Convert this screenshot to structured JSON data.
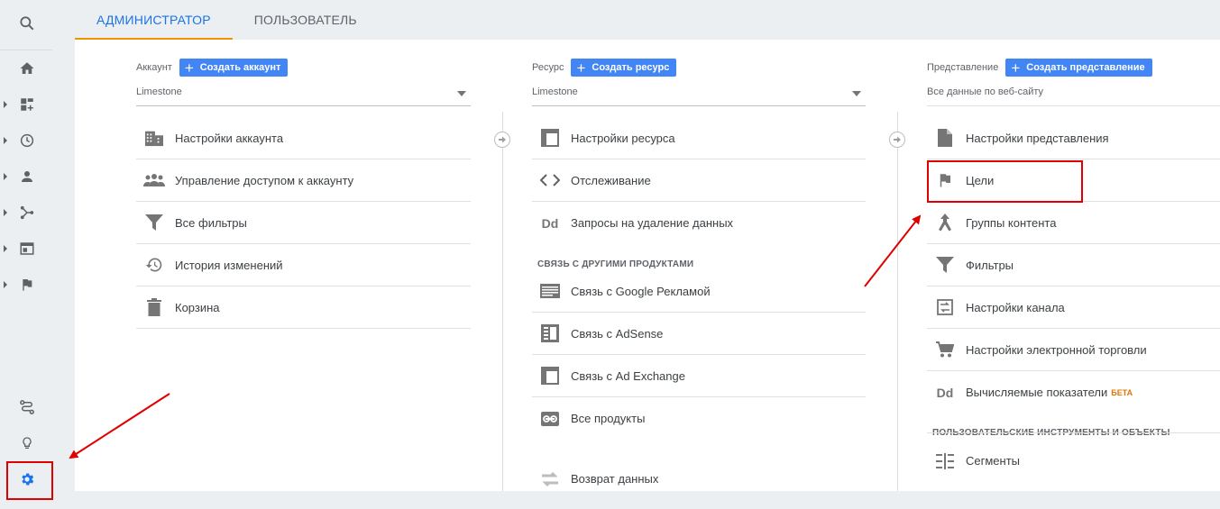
{
  "tabs": [
    {
      "label": "АДМИНИСТРАТОР",
      "selected": true
    },
    {
      "label": "ПОЛЬЗОВАТЕЛЬ",
      "selected": false
    }
  ],
  "rail": {
    "top_icons": [
      "search-icon"
    ],
    "nav_icons": [
      "home-icon",
      "customization-icon",
      "realtime-icon",
      "audience-icon",
      "acquisition-icon",
      "behavior-icon",
      "conversions-icon"
    ],
    "bottom_icons": [
      "attribution-icon",
      "discover-icon",
      "admin-gear-icon"
    ]
  },
  "account": {
    "label": "Аккаунт",
    "create_button": "Создать аккаунт",
    "selected": "Limestone",
    "items": [
      {
        "label": "Настройки аккаунта",
        "icon": "building-icon"
      },
      {
        "label": "Управление доступом к аккаунту",
        "icon": "people-icon"
      },
      {
        "label": "Все фильтры",
        "icon": "filter-icon"
      },
      {
        "label": "История изменений",
        "icon": "history-icon"
      },
      {
        "label": "Корзина",
        "icon": "trash-icon"
      }
    ]
  },
  "property": {
    "label": "Ресурс",
    "create_button": "Создать ресурс",
    "selected": "Limestone",
    "items": [
      {
        "label": "Настройки ресурса",
        "icon": "window-icon"
      },
      {
        "label": "Отслеживание",
        "icon": "code-icon"
      },
      {
        "label": "Запросы на удаление данных",
        "icon": "dd-icon"
      }
    ],
    "links_title": "СВЯЗЬ С ДРУГИМИ ПРОДУКТАМИ",
    "links": [
      {
        "label": "Связь с Google Рекламой",
        "icon": "ads-icon"
      },
      {
        "label": "Связь с AdSense",
        "icon": "adsense-icon"
      },
      {
        "label": "Связь с Ad Exchange",
        "icon": "adexchange-icon"
      },
      {
        "label": "Все продукты",
        "icon": "link-icon"
      }
    ],
    "extra_item": {
      "label": "Возврат данных",
      "icon": "postback-icon"
    }
  },
  "view": {
    "label": "Представление",
    "create_button": "Создать представление",
    "selected": "Все данные по веб-сайту",
    "items": [
      {
        "label": "Настройки представления",
        "icon": "document-icon"
      },
      {
        "label": "Цели",
        "icon": "flag-icon"
      },
      {
        "label": "Группы контента",
        "icon": "content-group-icon"
      },
      {
        "label": "Фильтры",
        "icon": "filter-icon"
      },
      {
        "label": "Настройки канала",
        "icon": "channel-icon"
      },
      {
        "label": "Настройки электронной торговли",
        "icon": "cart-icon"
      },
      {
        "label": "Вычисляемые показатели",
        "icon": "dd-icon",
        "badge": "БЕТА"
      }
    ],
    "tools_title": "ПОЛЬЗОВАТЕЛЬСКИЕ ИНСТРУМЕНТЫ И ОБЪЕКТЫ",
    "tools": [
      {
        "label": "Сегменты",
        "icon": "segments-icon"
      }
    ]
  },
  "colors": {
    "accent": "#1a73e8",
    "button": "#4285f4",
    "tab_underline": "#f09300",
    "highlight": "#e00000"
  }
}
